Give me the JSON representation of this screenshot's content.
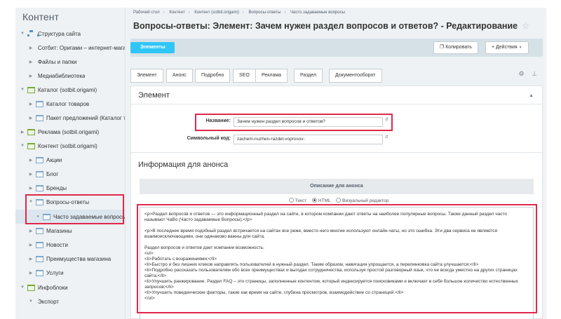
{
  "sidebar": {
    "title": "Контент",
    "items": [
      {
        "label": "Структура сайта",
        "icon": "structure-icon"
      },
      {
        "label": "Сотбит: Оригами – интернет-магазин"
      },
      {
        "label": "Файлы и папки"
      },
      {
        "label": "Медиабиблиотека"
      },
      {
        "label": "Каталог (sotbit.origami)"
      },
      {
        "label": "Каталог товаров"
      },
      {
        "label": "Пакет предложений (Каталог товаров)"
      },
      {
        "label": "Реклама (sotbit.origami)"
      },
      {
        "label": "Контент (sotbit.origami)"
      },
      {
        "label": "Акции"
      },
      {
        "label": "Блог"
      },
      {
        "label": "Бренды"
      },
      {
        "label": "Вопросы-ответы"
      },
      {
        "label": "Часто задаваемые вопросы"
      },
      {
        "label": "Магазины"
      },
      {
        "label": "Новости"
      },
      {
        "label": "Преимущества магазина"
      },
      {
        "label": "Услуги"
      },
      {
        "label": "Инфоблоки"
      },
      {
        "label": "Экспорт"
      }
    ]
  },
  "breadcrumb": [
    "Рабочий стол",
    "Контент",
    "Контент (sotbit.origami)",
    "Вопросы-ответы",
    "Часто задаваемые вопросы"
  ],
  "page_title": "Вопросы-ответы: Элемент: Зачем нужен раздел вопросов и ответов? - Редактирование",
  "toolbar": {
    "elements_label": "Элементы",
    "copy_label": "Копировать",
    "actions_label": "Действия"
  },
  "tabs": [
    "Элемент",
    "Анонс",
    "Подробно",
    "SEO",
    "Реклама",
    "Раздел",
    "Документооборот"
  ],
  "form": {
    "section_element": "Элемент",
    "name_label": "Название:",
    "name_value": "Зачем нужен раздел вопросов и ответов?",
    "code_label": "Символьный код:",
    "code_value": "zachem-nuzhen-razdel-voprosov-",
    "section_announce": "Информация для анонса",
    "desc_header": "Описание для анонса",
    "mode_text": "Текст",
    "mode_html": "HTML",
    "mode_visual": "Визуальный редактор",
    "content_lines": [
      "<p>Раздел вопросов и ответов — это информационный раздел на сайте, в котором компании дают ответы на наиболее популярные вопросы. Также данный раздел часто называют ЧаВо (Часто задаваемые Вопросы).</p>",
      "<p>В последнее время подобный раздел встречается на сайтах все реже, вместо него многие используют онлайн-чаты, но это ошибка. Эти два сервиса не являются взаимоисключающими, они одинаково важны для сайта.",
      "Раздел вопросов и ответов дает компании возможность:",
      "<ul>",
      "<li>Работать с возражениями;</li>",
      "<li>Быстро и без лишних кликов направлять пользователей в нужный раздел. Таким образом, навигация упрощается, а перелинковка сайта улучшается;</li>",
      "<li>Подробно рассказать пользователям обо всех преимуществах и выгодах сотрудничества, используя простой разговорный язык, что не всегда уместно на других страницах сайта;</li>",
      "<li>Улучшить ранжирование. Раздел FAQ – это страницы, заполненные контентом, который индексируется поисковиками и включает в себя большое количество естественных запросов;</li>",
      "<li>Улучшить поведенческие факторы, такие как время на сайте, глубина просмотров, взаимодействие со страницей.</li>",
      "</ul>"
    ]
  }
}
